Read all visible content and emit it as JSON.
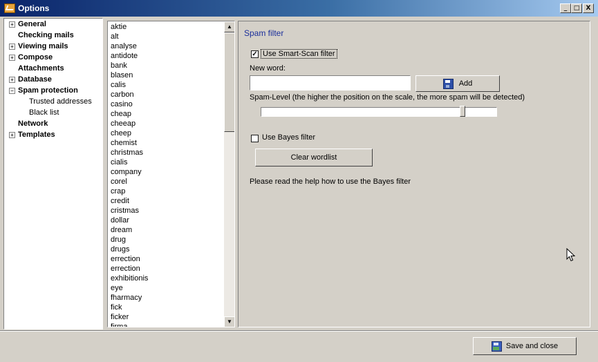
{
  "window": {
    "title": "Options",
    "minimize": "_",
    "maximize": "□",
    "close": "X"
  },
  "tree": [
    {
      "label": "General",
      "expander": "+",
      "bold": true
    },
    {
      "label": "Checking mails",
      "expander": "",
      "bold": true
    },
    {
      "label": "Viewing mails",
      "expander": "+",
      "bold": true
    },
    {
      "label": "Compose",
      "expander": "+",
      "bold": true
    },
    {
      "label": "Attachments",
      "expander": "",
      "bold": true
    },
    {
      "label": "Database",
      "expander": "+",
      "bold": true
    },
    {
      "label": "Spam protection",
      "expander": "−",
      "bold": true
    },
    {
      "label": "Trusted addresses",
      "expander": "",
      "bold": false,
      "child": true
    },
    {
      "label": "Black list",
      "expander": "",
      "bold": false,
      "child": true
    },
    {
      "label": "Network",
      "expander": "",
      "bold": true
    },
    {
      "label": "Templates",
      "expander": "+",
      "bold": true
    }
  ],
  "words": [
    "aktie",
    "alt",
    "analyse",
    "antidote",
    "bank",
    "blasen",
    "calis",
    "carbon",
    "casino",
    "cheap",
    "cheeap",
    "cheep",
    "chemist",
    "christmas",
    "cialis",
    "company",
    "corel",
    "crap",
    "credit",
    "cristmas",
    "dollar",
    "dream",
    "drug",
    "drugs",
    "errection",
    "errection",
    "exhibitionis",
    "eye",
    "fharmacy",
    "fick",
    "ficker",
    "firma"
  ],
  "spam": {
    "title": "Spam filter",
    "smart_scan_label": "Use Smart-Scan filter",
    "smart_scan_checked": true,
    "new_word_label": "New word:",
    "new_word_value": "",
    "add_label": "Add",
    "spam_level_label": "Spam-Level (the higher the position on the scale, the more spam will be detected)",
    "spam_level": 0.87,
    "bayes_label": "Use Bayes filter",
    "bayes_checked": false,
    "clear_label": "Clear wordlist",
    "help_text": "Please read the help how to use the Bayes filter"
  },
  "footer": {
    "save_label": "Save and close"
  }
}
